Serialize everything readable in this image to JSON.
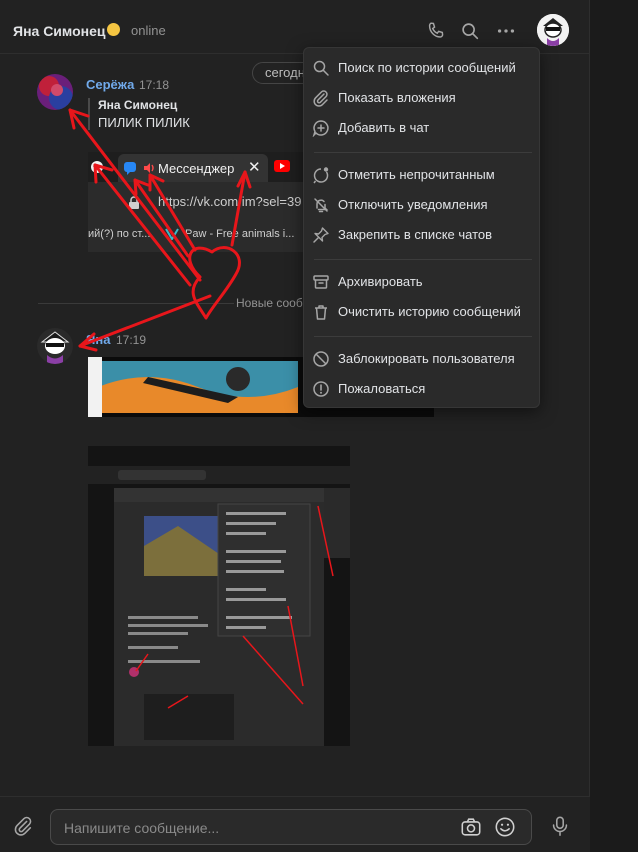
{
  "header": {
    "peer_name": "Яна Симонец",
    "status": "online",
    "icons": [
      "phone-icon",
      "search-icon",
      "more-icon"
    ]
  },
  "date_pill": "сегодн",
  "messages": [
    {
      "author": "Серёжа",
      "time": "17:18",
      "forward": {
        "name": "Яна Симонец",
        "text": "ПИЛИК ПИЛИК"
      },
      "browser_screenshot": {
        "tab_label": "Мессенджер",
        "tab_close": "✕",
        "url": "https://vk.com/im?sel=39",
        "bookmark_1": "ий(?) по ст...",
        "bookmark_2": "Paw - Free animals i..."
      }
    },
    {
      "author": "Яна",
      "time": "17:19"
    }
  ],
  "divider_label": "Новые сообщ",
  "menu": {
    "items": [
      {
        "label": "Поиск по истории сообщений",
        "icon": "search-icon"
      },
      {
        "label": "Показать вложения",
        "icon": "paperclip-icon"
      },
      {
        "label": "Добавить в чат",
        "icon": "add-chat-icon"
      },
      {
        "label": "Отметить непрочитанным",
        "icon": "unread-icon"
      },
      {
        "label": "Отключить уведомления",
        "icon": "bell-off-icon"
      },
      {
        "label": "Закрепить в списке чатов",
        "icon": "pin-icon"
      },
      {
        "label": "Архивировать",
        "icon": "archive-icon"
      },
      {
        "label": "Очистить историю сообщений",
        "icon": "trash-icon"
      },
      {
        "label": "Заблокировать пользователя",
        "icon": "block-icon"
      },
      {
        "label": "Пожаловаться",
        "icon": "report-icon"
      }
    ]
  },
  "composer": {
    "placeholder": "Напишите сообщение...",
    "icons": [
      "attach-icon",
      "camera-icon",
      "emoji-icon",
      "microphone-icon"
    ]
  },
  "colors": {
    "background": "#222222",
    "accent": "#71aaeb",
    "annotation_red": "#e8161b"
  }
}
